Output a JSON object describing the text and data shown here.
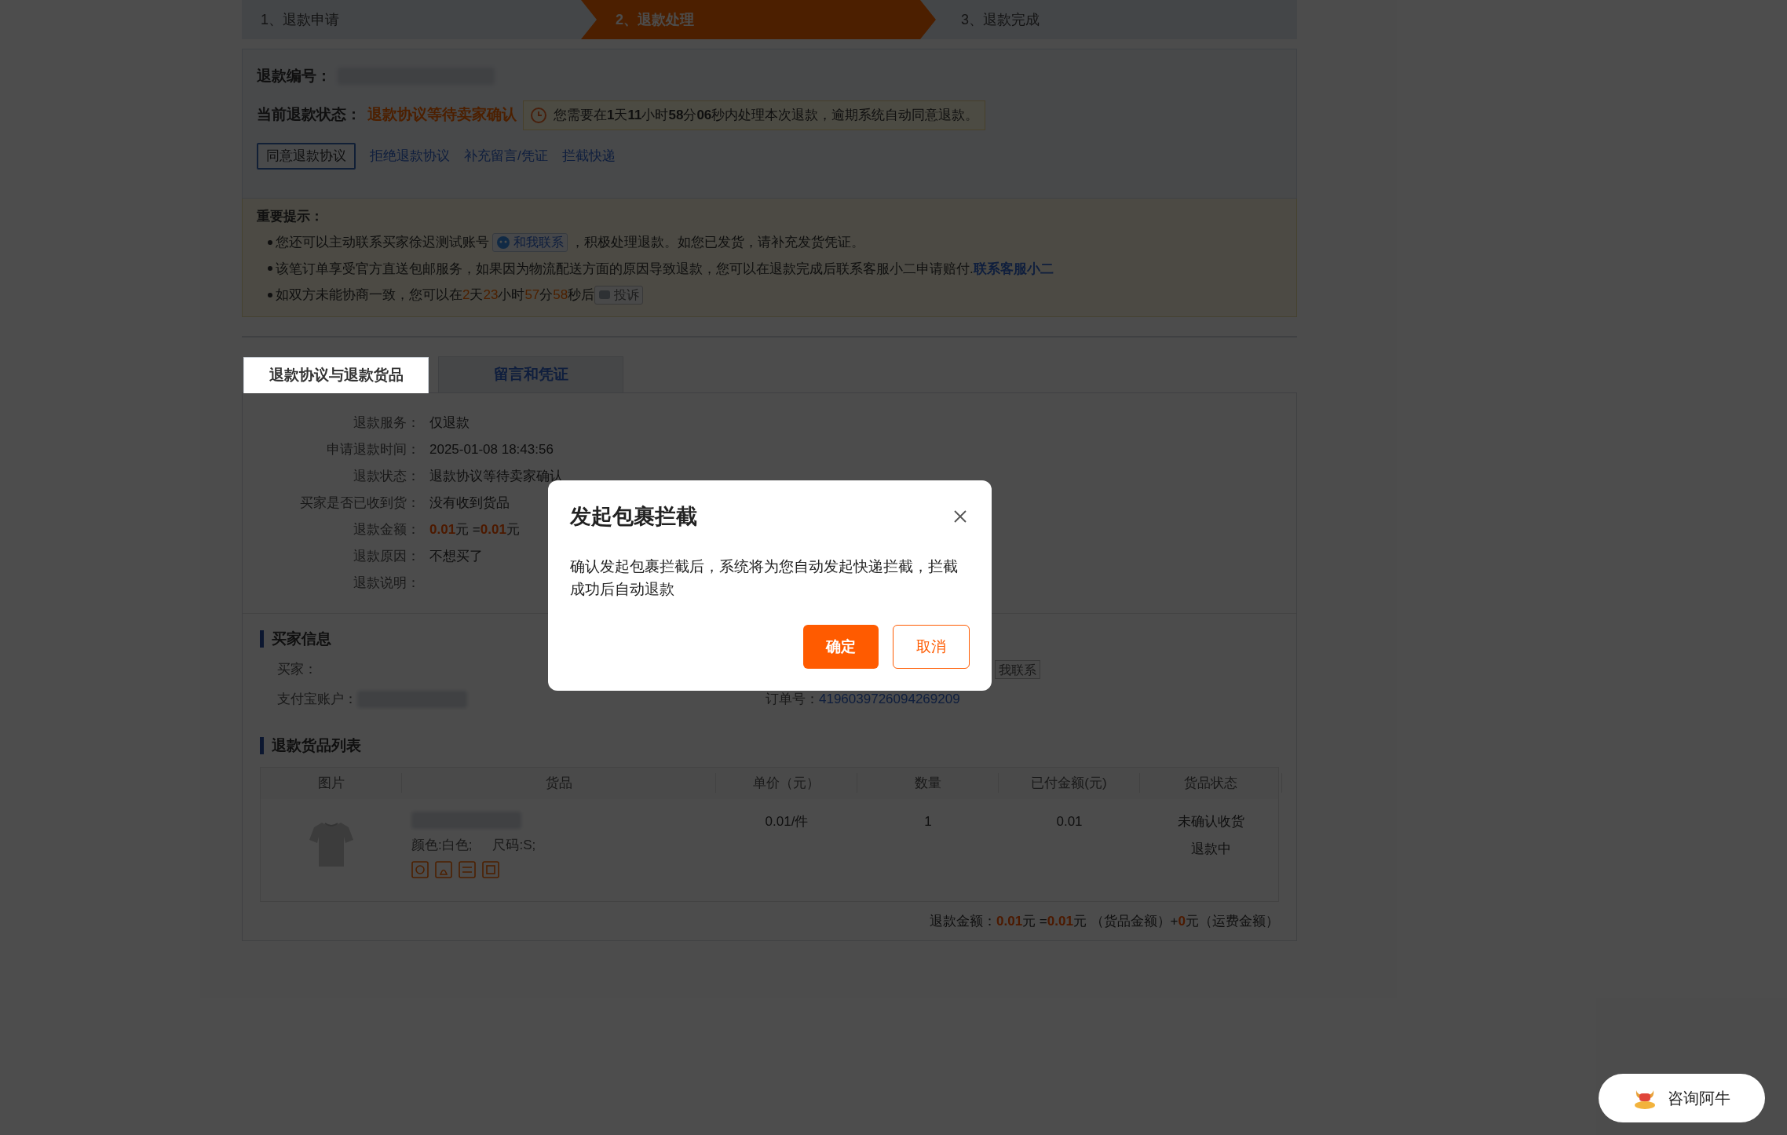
{
  "steps": [
    {
      "label": "1、退款申请",
      "selected": false
    },
    {
      "label": "2、退款处理",
      "selected": true
    },
    {
      "label": "3、退款完成",
      "selected": false
    }
  ],
  "refund_no": {
    "label": "退款编号："
  },
  "status": {
    "label": "当前退款状态：",
    "value": "退款协议等待卖家确认",
    "notice": "您需要在**1**天**11**小时**58**分**06**秒内处理本次退款，逾期系统自动同意退款。"
  },
  "actions": [
    {
      "label": "同意退款协议",
      "kind": "button"
    },
    {
      "label": "拒绝退款协议",
      "kind": "link"
    },
    {
      "label": "补充留言/凭证",
      "kind": "link"
    },
    {
      "label": "拦截快递",
      "kind": "link"
    }
  ],
  "tips": {
    "title": "重要提示：",
    "items": [
      [
        {
          "kind": "text",
          "text": "您还可以主动联系买家徐迟测试账号"
        },
        {
          "kind": "contact",
          "text": "和我联系"
        },
        {
          "kind": "text",
          "text": "，积极处理退款。如您已发货，请补充发货凭证。"
        }
      ],
      [
        {
          "kind": "text",
          "text": "该笔订单享受官方直送包邮服务，如果因为物流配送方面的原因导致退款，您可以在退款完成后联系客服小二申请赔付."
        },
        {
          "kind": "link",
          "text": "联系客服小二"
        }
      ],
      [
        {
          "kind": "text",
          "text": "如双方未能协商一致，您可以在"
        },
        {
          "kind": "num",
          "text": "2"
        },
        {
          "kind": "text",
          "text": "天"
        },
        {
          "kind": "num",
          "text": "23"
        },
        {
          "kind": "text",
          "text": "小时"
        },
        {
          "kind": "num",
          "text": "57"
        },
        {
          "kind": "text",
          "text": "分"
        },
        {
          "kind": "num",
          "text": "58"
        },
        {
          "kind": "text",
          "text": "秒后"
        },
        {
          "kind": "complain",
          "text": "投诉"
        }
      ]
    ]
  },
  "tabs": [
    {
      "label": "退款协议与退款货品",
      "selected": true
    },
    {
      "label": "留言和凭证",
      "selected": false
    }
  ],
  "details": [
    {
      "label": "退款服务：",
      "value": [
        {
          "kind": "text",
          "text": "仅退款"
        }
      ]
    },
    {
      "label": "申请退款时间：",
      "value": [
        {
          "kind": "text",
          "text": "2025-01-08 18:43:56"
        }
      ]
    },
    {
      "label": "退款状态：",
      "value": [
        {
          "kind": "text",
          "text": "退款协议等待卖家确认"
        }
      ]
    },
    {
      "label": "买家是否已收到货：",
      "value": [
        {
          "kind": "text",
          "text": "没有收到货品"
        }
      ]
    },
    {
      "label": "退款金额：",
      "value": [
        {
          "kind": "num",
          "text": "0.01"
        },
        {
          "kind": "text",
          "text": "元 ="
        },
        {
          "kind": "num",
          "text": "0.01"
        },
        {
          "kind": "text",
          "text": "元"
        }
      ]
    },
    {
      "label": "退款原因：",
      "value": [
        {
          "kind": "text",
          "text": "不想买了"
        }
      ]
    },
    {
      "label": "退款说明："
    }
  ],
  "buyer": {
    "title": "买家信息",
    "buyer_label": "买家：",
    "alipay_label": "支付宝账户：",
    "contact": "我联系",
    "order_label": "订单号：",
    "order_no": "4196039726094269209"
  },
  "goods": {
    "title": "退款货品列表",
    "columns": [
      "图片",
      "货品",
      "单价（元）",
      "数量",
      "已付金额(元)",
      "货品状态"
    ],
    "rows": [
      {
        "kind": "picture",
        "specs": [
          "颜色:白色;",
          "尺码:S;"
        ],
        "price": "0.01/件",
        "qty": "1",
        "paid": "0.01",
        "status": [
          "未确认收货",
          "退款中"
        ]
      }
    ]
  },
  "total": [
    {
      "kind": "text",
      "text": "退款金额："
    },
    {
      "kind": "num",
      "text": "0.01"
    },
    {
      "kind": "text",
      "text": "元 ="
    },
    {
      "kind": "num",
      "text": "0.01"
    },
    {
      "kind": "text",
      "text": "元 （货品金额）+"
    },
    {
      "kind": "num",
      "text": "0"
    },
    {
      "kind": "text",
      "text": "元（运费金额）"
    }
  ],
  "modal": {
    "title": "发起包裹拦截",
    "body": "确认发起包裹拦截后，系统将为您自动发起快递拦截，拦截成功后自动退款",
    "confirm": "确定",
    "cancel": "取消"
  },
  "chat": {
    "label": "咨询阿牛"
  }
}
